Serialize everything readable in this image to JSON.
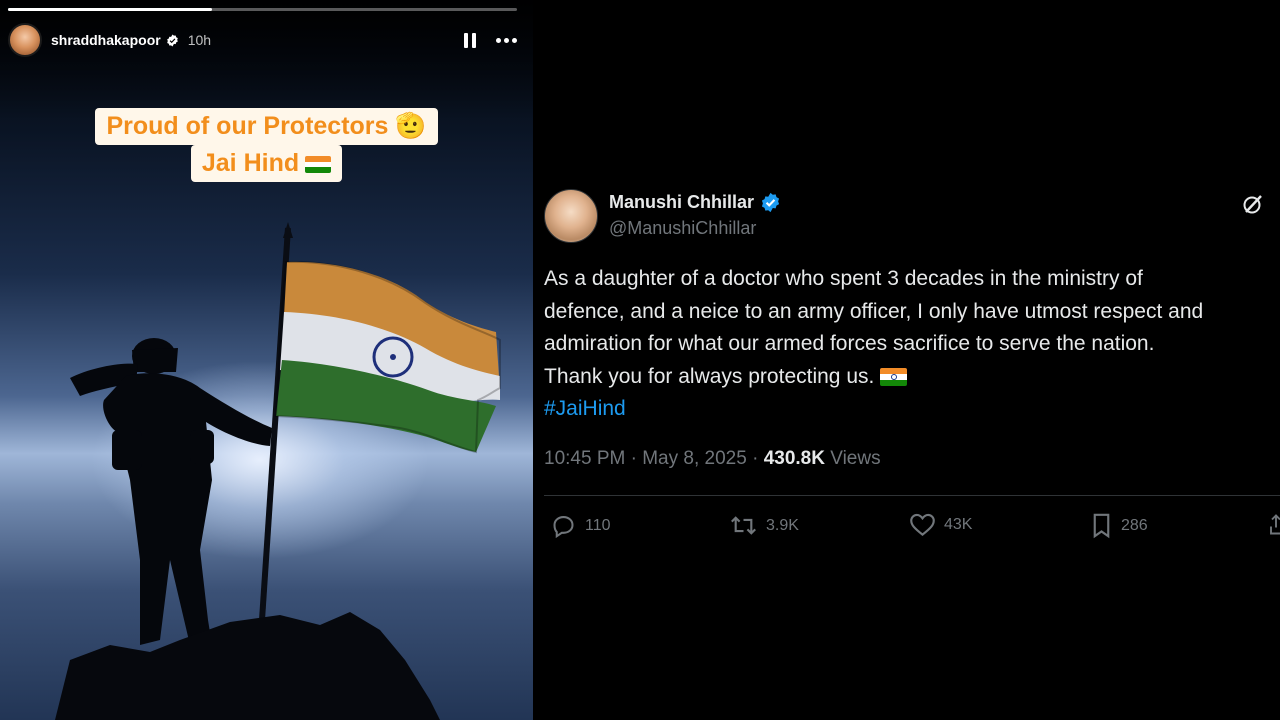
{
  "story": {
    "progress_fraction": 0.4,
    "username": "shraddhakapoor",
    "time": "10h",
    "caption": {
      "line1": "Proud of our Protectors",
      "line1_emoji": "🫡",
      "line2": "Jai Hind"
    },
    "icons": [
      "verified-icon",
      "pause-icon",
      "more-icon",
      "saluting-face-emoji",
      "india-flag-emoji"
    ]
  },
  "tweet": {
    "name": "Manushi Chhillar",
    "handle": "@ManushiChhillar",
    "body_lines": [
      "As a daughter of a doctor who spent 3 decades in the ministry of",
      "defence, and a neice to an army officer, I only have utmost respect and",
      "admiration for what our armed forces sacrifice to serve the nation.",
      "Thank you for always protecting us."
    ],
    "hashtag": "#JaiHind",
    "time": "10:45 PM",
    "separator": "·",
    "date": "May 8, 2025",
    "views_count": "430.8K",
    "views_label": "Views",
    "actions": {
      "replies": "110",
      "reposts": "3.9K",
      "likes": "43K",
      "bookmarks": "286"
    },
    "colors": {
      "accent": "#1d9bf0",
      "text": "#e7e9ea",
      "muted": "#71767b",
      "border": "#2f3336"
    }
  }
}
